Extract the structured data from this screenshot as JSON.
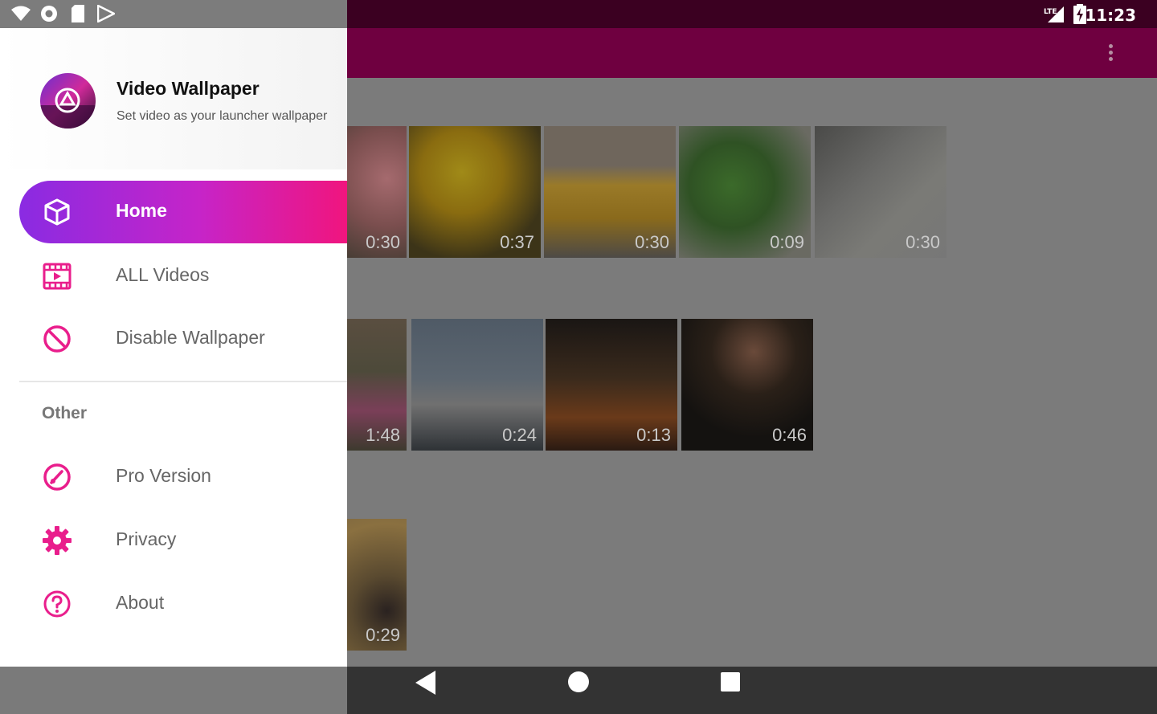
{
  "status_bar": {
    "time": "11:23",
    "network": "LTE",
    "left_icons": [
      "wifi-icon",
      "sync-icon",
      "sd-card-icon",
      "play-store-icon"
    ],
    "right_icons": [
      "lte-signal-icon",
      "battery-charging-icon"
    ]
  },
  "app_bar": {
    "overflow_icon": "more-vert-icon"
  },
  "drawer": {
    "app_name": "Video Wallpaper",
    "app_subtitle": "Set video as your launcher wallpaper",
    "accent_color": "#e91e8c",
    "gradient": [
      "#8a2be2",
      "#f0157e"
    ],
    "items": [
      {
        "label": "Home",
        "icon": "cube-icon",
        "active": true
      },
      {
        "label": "ALL Videos",
        "icon": "film-icon",
        "active": false
      },
      {
        "label": "Disable Wallpaper",
        "icon": "block-icon",
        "active": false
      }
    ],
    "section_other": "Other",
    "other_items": [
      {
        "label": "Pro Version",
        "icon": "gauge-icon"
      },
      {
        "label": "Privacy",
        "icon": "gear-icon"
      },
      {
        "label": "About",
        "icon": "help-icon"
      }
    ]
  },
  "videos": {
    "row1": [
      "0:30",
      "0:37",
      "0:30",
      "0:09",
      "0:30"
    ],
    "row2": [
      "1:48",
      "0:24",
      "0:13",
      "0:46"
    ],
    "row3": [
      "0:29"
    ]
  },
  "nav_bar": {
    "buttons": [
      "back-icon",
      "home-icon",
      "recents-icon"
    ]
  }
}
